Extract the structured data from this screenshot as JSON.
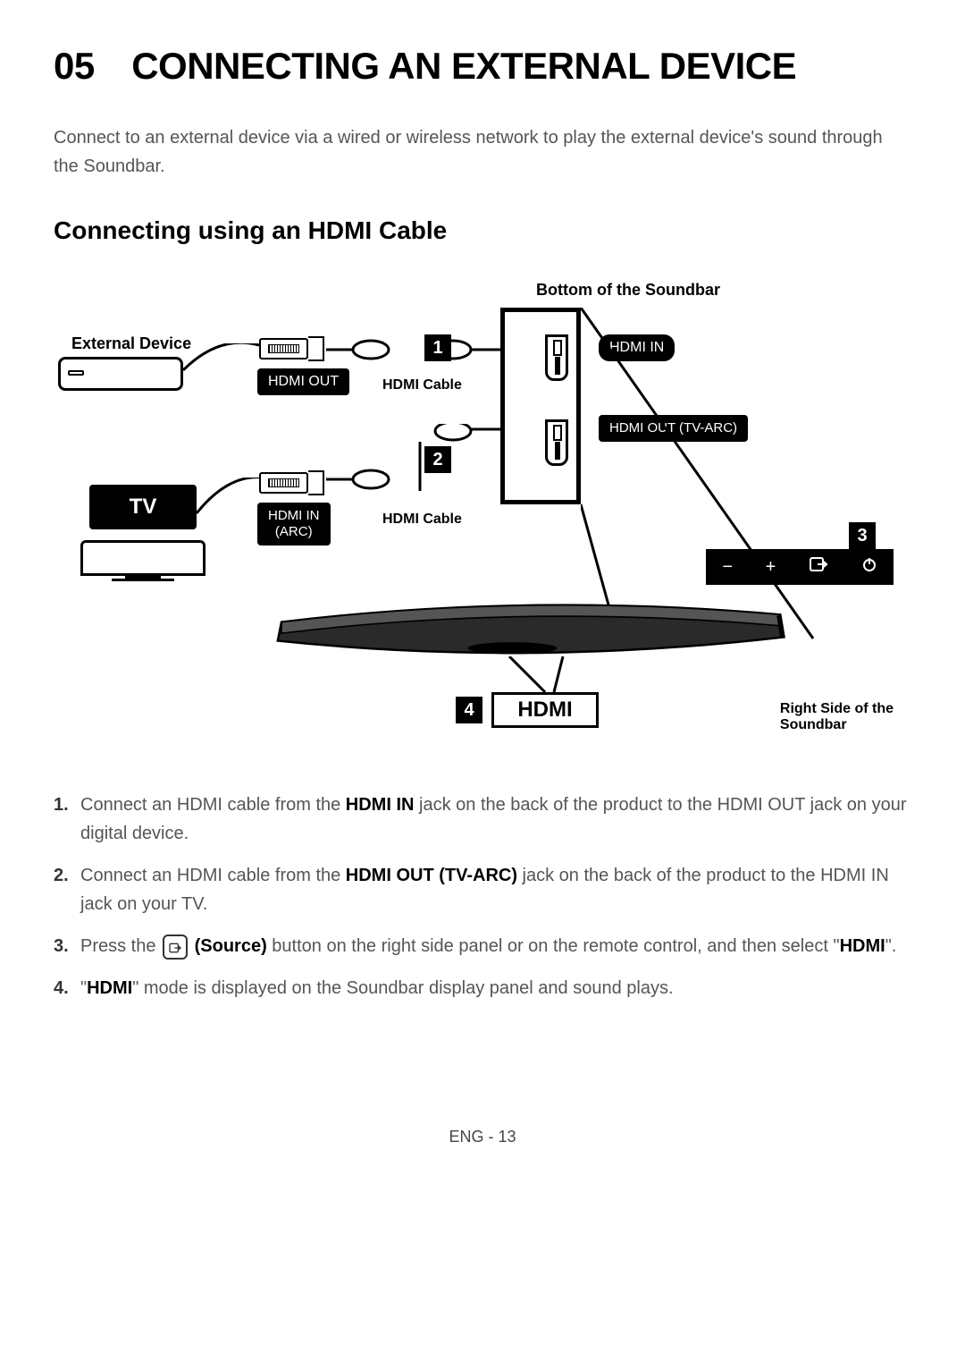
{
  "title": "05 CONNECTING AN EXTERNAL DEVICE",
  "intro": "Connect to an external device via a wired or wireless network to play the external device's sound through the Soundbar.",
  "section_title": "Connecting using an HDMI Cable",
  "diagram": {
    "labels": {
      "external_device": "External Device",
      "bottom_soundbar": "Bottom of the Soundbar",
      "right_side": "Right Side of the Soundbar",
      "tv": "TV",
      "hdmi_out": "HDMI OUT",
      "hdmi_in": "HDMI IN",
      "hdmi_in_arc": "HDMI IN (ARC)",
      "hdmi_out_tvarc": "HDMI OUT (TV-ARC)",
      "hdmi_cable_1": "HDMI Cable",
      "hdmi_cable_2": "HDMI Cable",
      "hdmi_display": "HDMI"
    },
    "badges": [
      "1",
      "2",
      "3",
      "4"
    ],
    "side_buttons": {
      "minus": "−",
      "plus": "+",
      "source": "⤳",
      "power": "⏻"
    }
  },
  "instructions": [
    {
      "num": "1.",
      "parts": [
        "Connect an HDMI cable from the ",
        "HDMI IN",
        " jack on the back of the product to the HDMI OUT jack on your digital device."
      ]
    },
    {
      "num": "2.",
      "parts": [
        "Connect an HDMI cable from the ",
        "HDMI OUT (TV-ARC)",
        " jack on the back of the product to the HDMI IN jack on your TV."
      ]
    },
    {
      "num": "3.",
      "parts_special": true,
      "prefix": "Press the ",
      "source_label": "(Source)",
      "middle": " button on the right side panel or on the remote control, and then select \"",
      "bold_end": "HDMI",
      "suffix": "\"."
    },
    {
      "num": "4.",
      "parts": [
        "\"",
        "HDMI",
        "\" mode is displayed on the Soundbar display panel and sound plays."
      ]
    }
  ],
  "footer": "ENG - 13"
}
